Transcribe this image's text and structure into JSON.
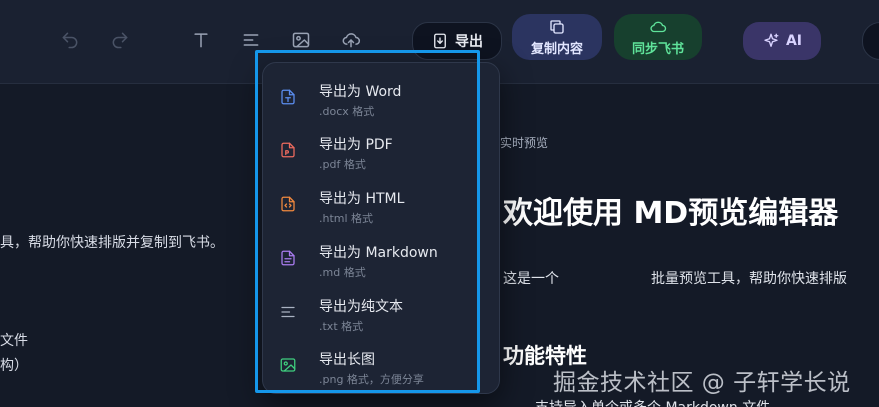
{
  "toolbar": {
    "export_label": "导出",
    "copy_label": "复制内容",
    "sync_label": "同步飞书",
    "ai_label": "AI",
    "icons": [
      "undo-icon",
      "redo-icon",
      "text-icon",
      "align-icon",
      "image-icon",
      "upload-cloud-icon"
    ]
  },
  "editor": {
    "line1": "具，帮助你快速排版并复制到飞书。",
    "line2": "文件",
    "line3": "构）"
  },
  "preview": {
    "pane_label": "实时预览",
    "title": "欢迎使用 MD预览编辑器",
    "para_prefix": "这是一个",
    "para_suffix": "批量预览工具，帮助你快速排版",
    "h2": "功能特性",
    "bottom_line": "支持导入单个或多个 Markdown 文件"
  },
  "watermark": "掘金技术社区 @ 子轩学长说",
  "export_menu": {
    "items": [
      {
        "title": "导出为 Word",
        "subtitle": ".docx 格式",
        "icon": "word-doc-icon",
        "color": "#5b8def"
      },
      {
        "title": "导出为 PDF",
        "subtitle": ".pdf 格式",
        "icon": "pdf-doc-icon",
        "color": "#ec6a5e"
      },
      {
        "title": "导出为 HTML",
        "subtitle": ".html 格式",
        "icon": "html-code-icon",
        "color": "#f0883e"
      },
      {
        "title": "导出为 Markdown",
        "subtitle": ".md 格式",
        "icon": "markdown-doc-icon",
        "color": "#a97cf0"
      },
      {
        "title": "导出为纯文本",
        "subtitle": ".txt 格式",
        "icon": "text-lines-icon",
        "color": "#aab2c2"
      },
      {
        "title": "导出长图",
        "subtitle": ".png 格式，方便分享",
        "icon": "image-icon",
        "color": "#3fcf7f"
      }
    ]
  },
  "colors": {
    "highlight": "#1597ea",
    "background": "#141a27",
    "toolbar": "#1a2131"
  }
}
